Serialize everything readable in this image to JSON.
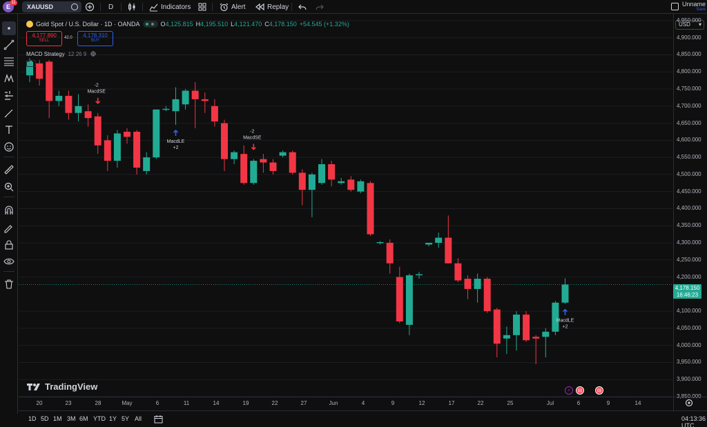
{
  "user": {
    "avatar_letter": "E",
    "notification_count": "11"
  },
  "topbar": {
    "symbol": "XAUUSD",
    "add_symbol_icon": "plus-circle-icon",
    "interval": "D",
    "indicators_label": "Indicators",
    "alert_label": "Alert",
    "replay_label": "Replay",
    "layout_name": "Unname",
    "save_label": "Save"
  },
  "legend": {
    "title": "Gold Spot / U.S. Dollar · 1D · OANDA",
    "o_label": "O",
    "o_value": "4,125.815",
    "h_label": "H",
    "h_value": "4,195.510",
    "l_label": "L",
    "l_value": "4,121.470",
    "c_label": "C",
    "c_value": "4,178.150",
    "change": "+54.545 (+1.32%)",
    "sell_price": "4,177.890",
    "sell_label": "SELL",
    "spread": "42.0",
    "buy_price": "4,178.310",
    "buy_label": "BUY",
    "indicator_name": "MACD Strategy",
    "indicator_params": "12 26 9",
    "collapse_glyph": "^"
  },
  "currency": "USD",
  "colors": {
    "up": "#22ab94",
    "down": "#f23645",
    "background": "#0f0f0f",
    "grid": "#1c1e24",
    "signal_long": "#2962ff",
    "signal_short": "#f23645"
  },
  "price_axis": {
    "ticks": [
      "4,950.000",
      "4,900.000",
      "4,850.000",
      "4,800.000",
      "4,750.000",
      "4,700.000",
      "4,650.000",
      "4,600.000",
      "4,550.000",
      "4,500.000",
      "4,450.000",
      "4,400.000",
      "4,350.000",
      "4,300.000",
      "4,250.000",
      "4,200.000",
      "4,100.000",
      "4,050.000",
      "4,000.000",
      "3,950.000",
      "3,900.000",
      "3,850.000"
    ],
    "last_price": "4,178.150",
    "countdown": "16:46:23"
  },
  "time_axis": {
    "labels": [
      "20",
      "23",
      "28",
      "May",
      "6",
      "11",
      "14",
      "19",
      "22",
      "27",
      "Jun",
      "4",
      "9",
      "12",
      "17",
      "22",
      "25",
      "Jul",
      "6",
      "9",
      "14"
    ]
  },
  "chart_data": {
    "type": "candlestick",
    "title": "Gold Spot / U.S. Dollar · 1D · OANDA",
    "ylim": [
      3850,
      4970
    ],
    "series": [
      {
        "name": "XAUUSD",
        "candles": [
          {
            "o": 4790,
            "h": 4840,
            "l": 4770,
            "c": 4830
          },
          {
            "o": 4825,
            "h": 4835,
            "l": 4760,
            "c": 4780
          },
          {
            "o": 4830,
            "h": 4835,
            "l": 4665,
            "c": 4715
          },
          {
            "o": 4715,
            "h": 4745,
            "l": 4700,
            "c": 4730
          },
          {
            "o": 4730,
            "h": 4745,
            "l": 4660,
            "c": 4680
          },
          {
            "o": 4680,
            "h": 4735,
            "l": 4655,
            "c": 4700
          },
          {
            "o": 4685,
            "h": 4705,
            "l": 4640,
            "c": 4665
          },
          {
            "o": 4670,
            "h": 4680,
            "l": 4560,
            "c": 4585
          },
          {
            "o": 4600,
            "h": 4615,
            "l": 4510,
            "c": 4540
          },
          {
            "o": 4540,
            "h": 4630,
            "l": 4520,
            "c": 4620
          },
          {
            "o": 4625,
            "h": 4635,
            "l": 4590,
            "c": 4610
          },
          {
            "o": 4625,
            "h": 4630,
            "l": 4500,
            "c": 4520
          },
          {
            "o": 4510,
            "h": 4565,
            "l": 4500,
            "c": 4550
          },
          {
            "o": 4550,
            "h": 4690,
            "l": 4545,
            "c": 4690
          },
          {
            "o": 4690,
            "h": 4700,
            "l": 4685,
            "c": 4692
          },
          {
            "o": 4685,
            "h": 4755,
            "l": 4645,
            "c": 4720
          },
          {
            "o": 4705,
            "h": 4750,
            "l": 4690,
            "c": 4745
          },
          {
            "o": 4745,
            "h": 4770,
            "l": 4635,
            "c": 4720
          },
          {
            "o": 4720,
            "h": 4740,
            "l": 4680,
            "c": 4715
          },
          {
            "o": 4700,
            "h": 4720,
            "l": 4640,
            "c": 4655
          },
          {
            "o": 4650,
            "h": 4660,
            "l": 4510,
            "c": 4545
          },
          {
            "o": 4545,
            "h": 4570,
            "l": 4530,
            "c": 4565
          },
          {
            "o": 4560,
            "h": 4585,
            "l": 4470,
            "c": 4475
          },
          {
            "o": 4475,
            "h": 4545,
            "l": 4470,
            "c": 4540
          },
          {
            "o": 4545,
            "h": 4560,
            "l": 4505,
            "c": 4535
          },
          {
            "o": 4535,
            "h": 4545,
            "l": 4500,
            "c": 4510
          },
          {
            "o": 4555,
            "h": 4570,
            "l": 4550,
            "c": 4565
          },
          {
            "o": 4565,
            "h": 4570,
            "l": 4500,
            "c": 4505
          },
          {
            "o": 4505,
            "h": 4515,
            "l": 4410,
            "c": 4455
          },
          {
            "o": 4455,
            "h": 4505,
            "l": 4375,
            "c": 4500
          },
          {
            "o": 4475,
            "h": 4545,
            "l": 4470,
            "c": 4530
          },
          {
            "o": 4530,
            "h": 4540,
            "l": 4465,
            "c": 4485
          },
          {
            "o": 4475,
            "h": 4490,
            "l": 4470,
            "c": 4480
          },
          {
            "o": 4485,
            "h": 4495,
            "l": 4450,
            "c": 4455
          },
          {
            "o": 4450,
            "h": 4485,
            "l": 4445,
            "c": 4480
          },
          {
            "o": 4475,
            "h": 4480,
            "l": 4320,
            "c": 4325
          },
          {
            "o": 4300,
            "h": 4305,
            "l": 4295,
            "c": 4302
          },
          {
            "o": 4300,
            "h": 4310,
            "l": 4210,
            "c": 4240
          },
          {
            "o": 4200,
            "h": 4230,
            "l": 4065,
            "c": 4070
          },
          {
            "o": 4060,
            "h": 4210,
            "l": 4030,
            "c": 4205
          },
          {
            "o": 4205,
            "h": 4215,
            "l": 4195,
            "c": 4208
          },
          {
            "o": 4295,
            "h": 4300,
            "l": 4290,
            "c": 4300
          },
          {
            "o": 4300,
            "h": 4330,
            "l": 4285,
            "c": 4315
          },
          {
            "o": 4315,
            "h": 4380,
            "l": 4240,
            "c": 4240
          },
          {
            "o": 4240,
            "h": 4255,
            "l": 4185,
            "c": 4190
          },
          {
            "o": 4195,
            "h": 4205,
            "l": 4135,
            "c": 4165
          },
          {
            "o": 4165,
            "h": 4210,
            "l": 4125,
            "c": 4195
          },
          {
            "o": 4195,
            "h": 4200,
            "l": 4095,
            "c": 4100
          },
          {
            "o": 4105,
            "h": 4110,
            "l": 3965,
            "c": 4005
          },
          {
            "o": 4020,
            "h": 4055,
            "l": 3975,
            "c": 4030
          },
          {
            "o": 4030,
            "h": 4100,
            "l": 3985,
            "c": 4090
          },
          {
            "o": 4090,
            "h": 4100,
            "l": 4010,
            "c": 4015
          },
          {
            "o": 4025,
            "h": 4030,
            "l": 3945,
            "c": 4020
          },
          {
            "o": 4025,
            "h": 4050,
            "l": 3965,
            "c": 4040
          },
          {
            "o": 4040,
            "h": 4130,
            "l": 4030,
            "c": 4125
          },
          {
            "o": 4125,
            "h": 4196,
            "l": 4121,
            "c": 4178
          }
        ]
      }
    ],
    "signals": [
      {
        "bar": 7,
        "type": "short",
        "name": "MacdSE",
        "qty": "-2"
      },
      {
        "bar": 15,
        "type": "long",
        "name": "MacdLE",
        "qty": "+2"
      },
      {
        "bar": 23,
        "type": "short",
        "name": "MacdSE",
        "qty": "-2"
      },
      {
        "bar": 55,
        "type": "long",
        "name": "MacdLE",
        "qty": "+2"
      }
    ]
  },
  "watermark": "TradingView",
  "bottombar": {
    "ranges": [
      "1D",
      "5D",
      "1M",
      "3M",
      "6M",
      "YTD",
      "1Y",
      "5Y",
      "All"
    ],
    "clock": "04:13:36 UTC"
  }
}
